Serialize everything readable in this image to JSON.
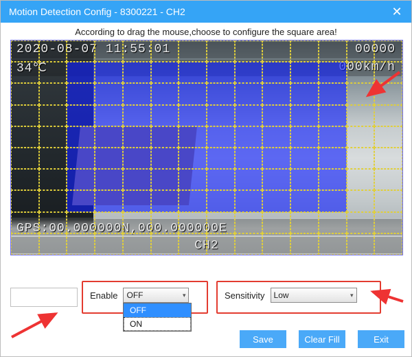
{
  "window": {
    "title": "Motion Detection Config - 8300221 - CH2"
  },
  "hint": "According to drag the mouse,choose to configure the square area!",
  "osd": {
    "timestamp": "2020-08-07 11:55:01",
    "counter": "00000",
    "temp": "34℃",
    "speed": "000km/h",
    "gps": "GPS:00.000000N,000.000000E",
    "channel": "CH2"
  },
  "grid": {
    "cols": 14,
    "rows": 10,
    "selection": {
      "r0": 1,
      "r1": 7,
      "c0": 2,
      "c1": 11
    }
  },
  "enable": {
    "label": "Enable",
    "value": "OFF",
    "options": [
      "OFF",
      "ON"
    ],
    "open": true,
    "highlight": "OFF",
    "focus": "ON"
  },
  "sensitivity": {
    "label": "Sensitivity",
    "value": "Low"
  },
  "buttons": {
    "save": "Save",
    "clear": "Clear Fill",
    "exit": "Exit"
  }
}
